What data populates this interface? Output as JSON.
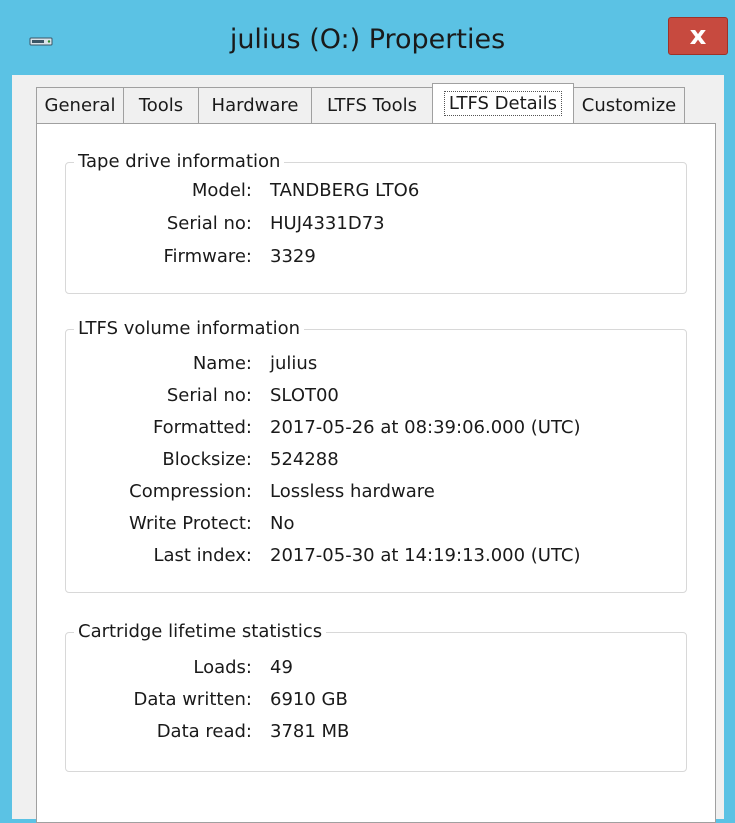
{
  "window": {
    "title": "julius (O:) Properties",
    "close_label": "x"
  },
  "tabs": [
    {
      "label": "General"
    },
    {
      "label": "Tools"
    },
    {
      "label": "Hardware"
    },
    {
      "label": "LTFS Tools"
    },
    {
      "label": "LTFS Details",
      "active": true
    },
    {
      "label": "Customize"
    }
  ],
  "tape_drive": {
    "title": "Tape drive information",
    "rows": [
      {
        "label": "Model:",
        "value": "TANDBERG LTO6"
      },
      {
        "label": "Serial no:",
        "value": "HUJ4331D73"
      },
      {
        "label": "Firmware:",
        "value": "3329"
      }
    ]
  },
  "ltfs_volume": {
    "title": "LTFS volume information",
    "rows": [
      {
        "label": "Name:",
        "value": "julius"
      },
      {
        "label": "Serial no:",
        "value": "SLOT00"
      },
      {
        "label": "Formatted:",
        "value": "2017-05-26 at 08:39:06.000 (UTC)"
      },
      {
        "label": "Blocksize:",
        "value": "524288"
      },
      {
        "label": "Compression:",
        "value": "Lossless hardware"
      },
      {
        "label": "Write Protect:",
        "value": "No"
      },
      {
        "label": "Last index:",
        "value": "2017-05-30 at 14:19:13.000 (UTC)"
      }
    ]
  },
  "cartridge": {
    "title": "Cartridge lifetime statistics",
    "rows": [
      {
        "label": "Loads:",
        "value": "49"
      },
      {
        "label": "Data written:",
        "value": "6910 GB"
      },
      {
        "label": "Data read:",
        "value": "3781 MB"
      }
    ]
  },
  "colors": {
    "title_bar": "#5bc2e4",
    "close_button": "#c74a3f",
    "dialog_background": "#f0f0f0"
  }
}
